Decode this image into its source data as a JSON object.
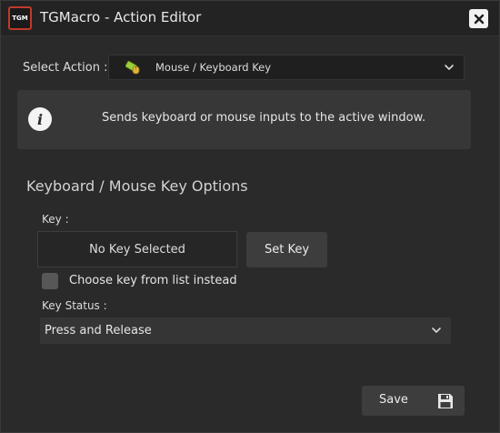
{
  "window": {
    "title": "TGMacro - Action Editor",
    "logo_text": "TGM",
    "close_icon": "close-icon"
  },
  "select_action": {
    "label": "Select Action :",
    "selected": "Mouse / Keyboard Key",
    "icon": "mouse-keyboard-icon"
  },
  "info": {
    "icon": "info-icon",
    "text": "Sends keyboard or mouse inputs to the active window."
  },
  "options": {
    "section_title": "Keyboard / Mouse Key Options",
    "key_label": "Key :",
    "key_value": "No Key Selected",
    "set_key_label": "Set Key",
    "checkbox_label": "Choose key from list instead",
    "checkbox_checked": false,
    "key_status_label": "Key Status :",
    "key_status_value": "Press and Release"
  },
  "footer": {
    "save_label": "Save",
    "save_icon": "floppy-disk-icon"
  },
  "colors": {
    "background": "#2a2a2a",
    "titlebar": "#232323",
    "panel": "#373737",
    "button": "#3d3d3d",
    "logo_accent": "#c0392b"
  }
}
